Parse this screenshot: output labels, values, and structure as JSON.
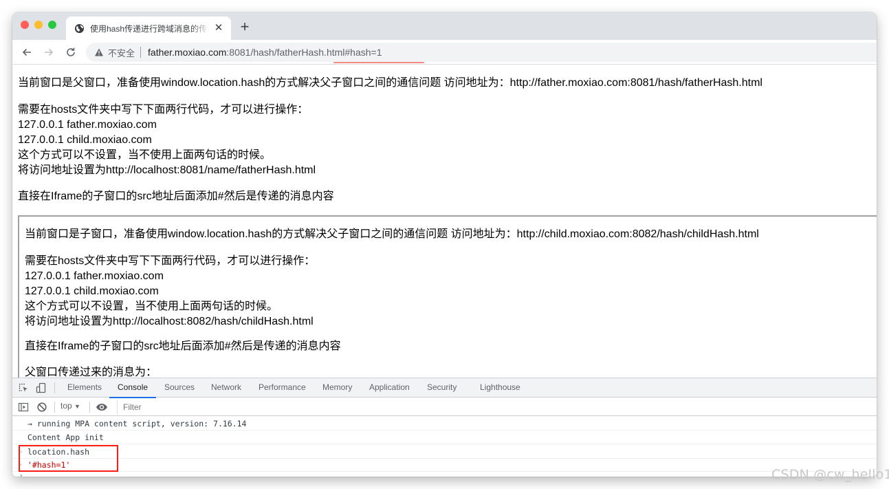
{
  "browser": {
    "tab": {
      "title": "使用hash传递进行跨域消息的传递",
      "favicon": "globe-icon"
    },
    "toolbar": {
      "security_label": "不安全",
      "url_host": "father.moxiao.com",
      "url_rest": ":8081/hash/fatherHash.html#hash=1"
    }
  },
  "page": {
    "intro": "当前窗口是父窗口，准备使用window.location.hash的方式解决父子窗口之间的通信问题 访问地址为：http://father.moxiao.com:8081/hash/fatherHash.html",
    "hosts_lines": [
      "需要在hosts文件夹中写下下面两行代码，才可以进行操作：",
      "127.0.0.1 father.moxiao.com",
      "127.0.0.1 child.moxiao.com",
      "这个方式可以不设置，当不使用上面两句话的时候。",
      "将访问地址设置为http://localhost:8081/name/fatherHash.html"
    ],
    "instruction": "直接在Iframe的子窗口的src地址后面添加#然后是传递的消息内容",
    "iframe": {
      "intro": "当前窗口是子窗口，准备使用window.location.hash的方式解决父子窗口之间的通信问题 访问地址为：http://child.moxiao.com:8082/hash/childHash.html",
      "hosts_lines": [
        "需要在hosts文件夹中写下下面两行代码，才可以进行操作：",
        "127.0.0.1 father.moxiao.com",
        "127.0.0.1 child.moxiao.com",
        "这个方式可以不设置，当不使用上面两句话的时候。",
        "将访问地址设置为http://localhost:8082/hash/childHash.html"
      ],
      "instruction": "直接在Iframe的子窗口的src地址后面添加#然后是传递的消息内容",
      "message_label": "父窗口传递过来的消息为："
    }
  },
  "devtools": {
    "tabs": [
      "Elements",
      "Console",
      "Sources",
      "Network",
      "Performance",
      "Memory",
      "Application",
      "Security",
      "Lighthouse"
    ],
    "active_tab": "Console",
    "context": "top",
    "filter_placeholder": "Filter",
    "console_lines": [
      {
        "type": "log",
        "text": "→ running MPA content script, version: 7.16.14"
      },
      {
        "type": "log",
        "text": "Content App init"
      },
      {
        "type": "input",
        "text": "location.hash"
      },
      {
        "type": "result",
        "text": "'#hash=1'"
      }
    ]
  },
  "colors": {
    "highlight_box": "#ff1d12",
    "url_underline": "#f28b82",
    "devtools_active": "#1a73e8",
    "console_string": "#c80000"
  },
  "watermark": "CSDN @cw_hello1"
}
